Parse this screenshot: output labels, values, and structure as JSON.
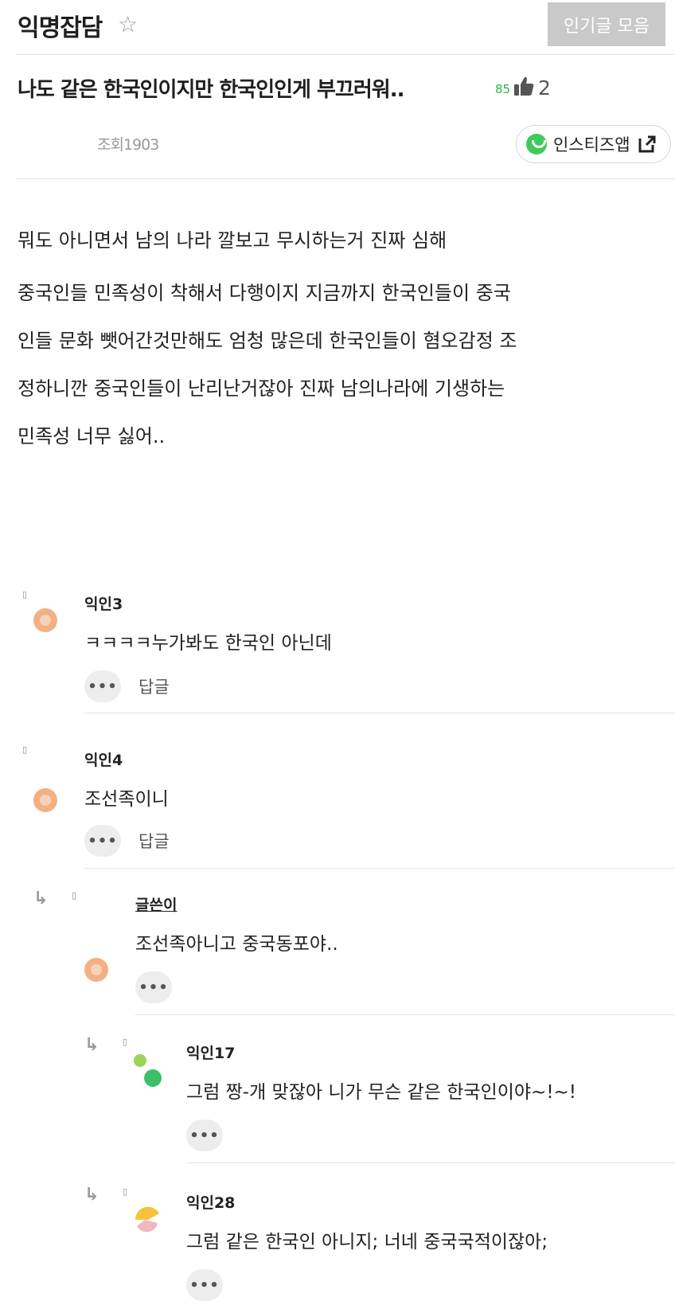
{
  "header": {
    "board_title": "익명잡담",
    "star_icon": "☆",
    "popular_button": "인기글 모음"
  },
  "post": {
    "title": "나도 같은 한국인이지만 한국인인게 부끄러워..",
    "score": "85",
    "like_count": "2",
    "views": "조회1903",
    "app_button": "인스티즈앱",
    "body": [
      "뭐도 아니면서 남의 나라 깔보고 무시하는거 진짜 심해",
      "중국인들 민족성이 착해서 다행이지 지금까지 한국인들이 중국",
      "인들 문화 뺏어간것만해도 엄청 많은데 한국인들이 혐오감정 조",
      "정하니깐 중국인들이 난리난거잖아 진짜 남의나라에 기생하는",
      "민족성 너무 싫어.."
    ]
  },
  "comments": [
    {
      "nick": "익인3",
      "text": "ㅋㅋㅋㅋ누가봐도 한국인 아닌데",
      "more": "•••",
      "reply": "답글"
    },
    {
      "nick": "익인4",
      "text": "조선족이니",
      "more": "•••",
      "reply": "답글"
    },
    {
      "nick": "글쓴이",
      "text": "조선족아니고 중국동포야..",
      "more": "•••"
    },
    {
      "nick": "익인17",
      "text": "그럼 짱-개 맞잖아 니가 무슨 같은 한국인이야~!~!",
      "more": "•••"
    },
    {
      "nick": "익인28",
      "text": "그럼 같은 한국인 아니지; 너네 중국국적이잖아;",
      "more": "•••"
    }
  ],
  "icons": {
    "reply_arrow": "↳",
    "marker": "▯",
    "colors": {
      "popular_button_bg": "#c9c9c9",
      "score_green": "#2db34a",
      "app_logo_green": "#3fc85b",
      "avatar_orange": "#f2b084",
      "avatar_green_light": "#9bd35a",
      "avatar_green": "#3cbf6a",
      "avatar_yellow": "#f6c23e",
      "avatar_pink": "#f2b6c0"
    }
  }
}
